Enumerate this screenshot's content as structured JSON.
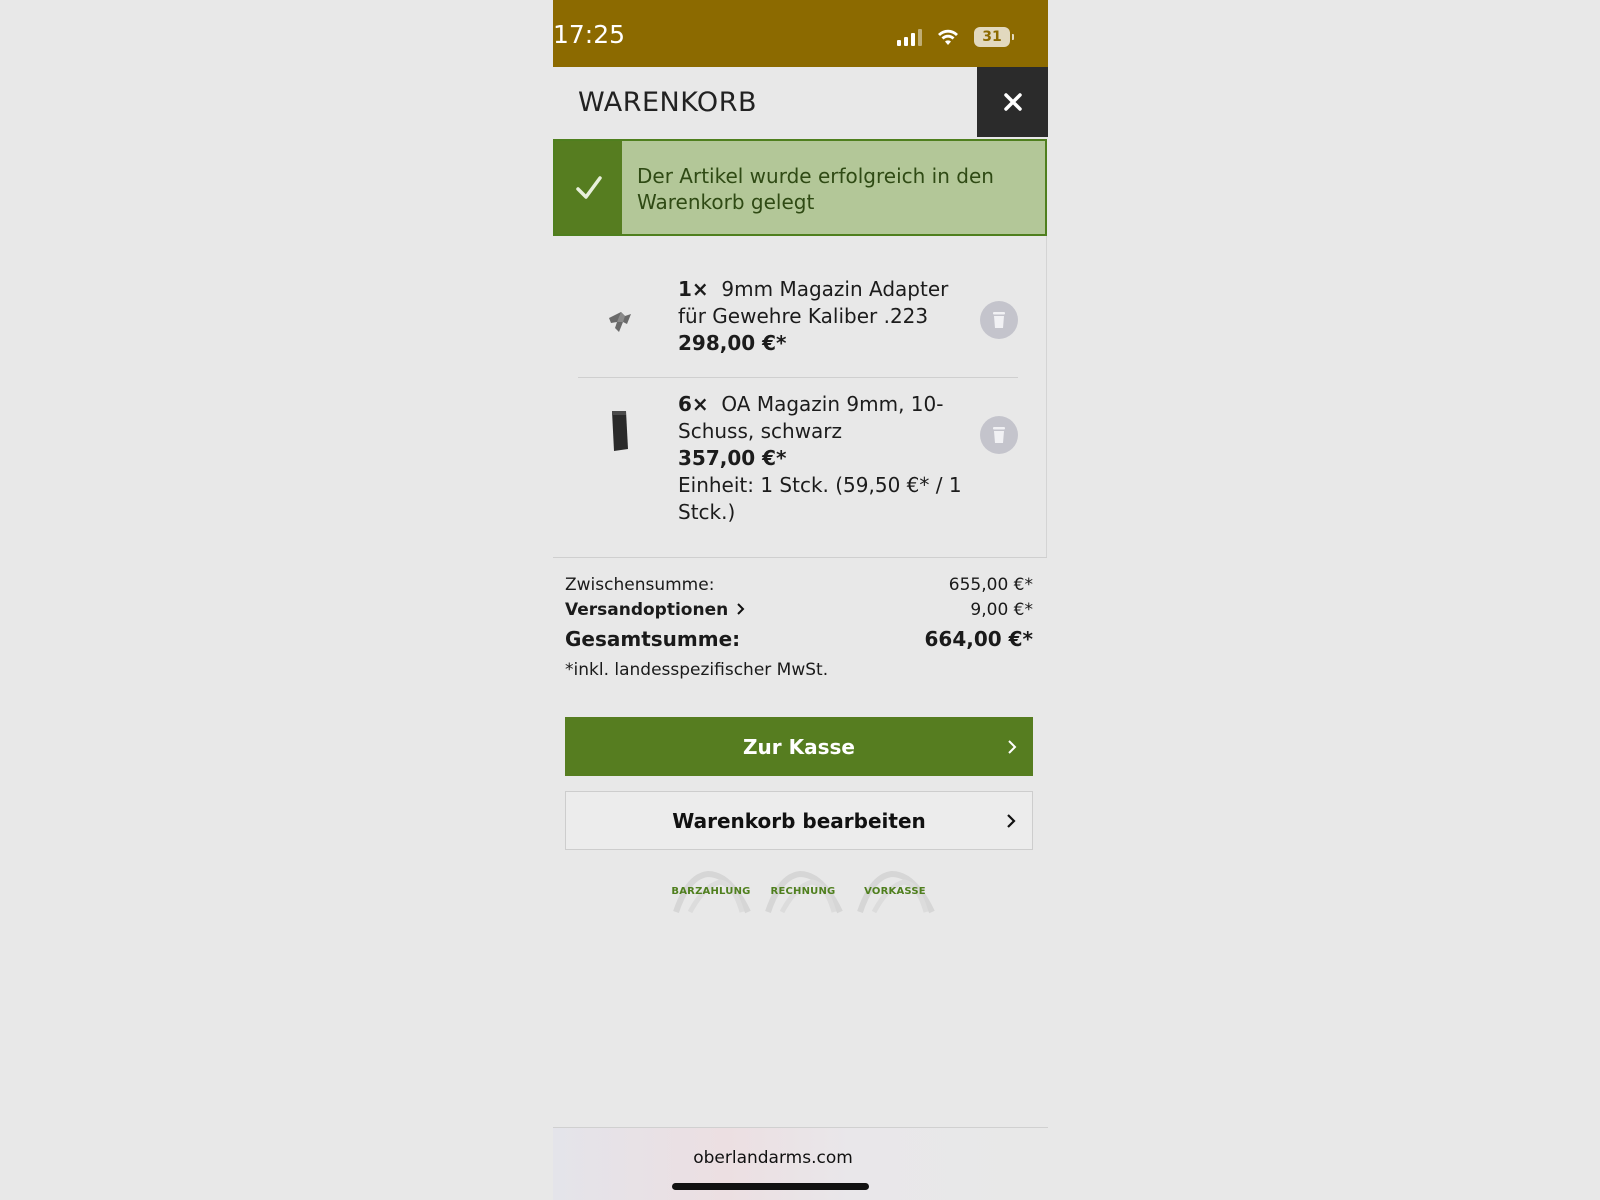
{
  "status_bar": {
    "time": "17:25",
    "battery": "31"
  },
  "header": {
    "title": "WARENKORB"
  },
  "banner": {
    "message": "Der Artikel wurde erfolgreich in den Warenkorb gelegt"
  },
  "items": [
    {
      "qty": "1×",
      "name": "9mm Magazin Adapter für Gewehre Kaliber .223",
      "price": "298,00 €*",
      "unit": ""
    },
    {
      "qty": "6×",
      "name": "OA Magazin 9mm, 10-Schuss, schwarz",
      "price": "357,00 €*",
      "unit": "Einheit: 1 Stck. (59,50 €* / 1 Stck.)"
    }
  ],
  "totals": {
    "subtotal_label": "Zwischensumme:",
    "subtotal_value": "655,00 €*",
    "shipping_label": "Versandoptionen",
    "shipping_value": "9,00 €*",
    "total_label": "Gesamtsumme:",
    "total_value": "664,00 €*",
    "vat_note": "*inkl. landesspezifischer MwSt."
  },
  "buttons": {
    "checkout": "Zur Kasse",
    "edit_cart": "Warenkorb bearbeiten"
  },
  "payment_methods": [
    "BARZAHLUNG",
    "RECHNUNG",
    "VORKASSE"
  ],
  "browser": {
    "url": "oberlandarms.com"
  },
  "colors": {
    "status_bar": "#8c6a00",
    "accent_green": "#567d20",
    "banner_bg": "#b3c798",
    "close_bg": "#2b2b2b"
  }
}
